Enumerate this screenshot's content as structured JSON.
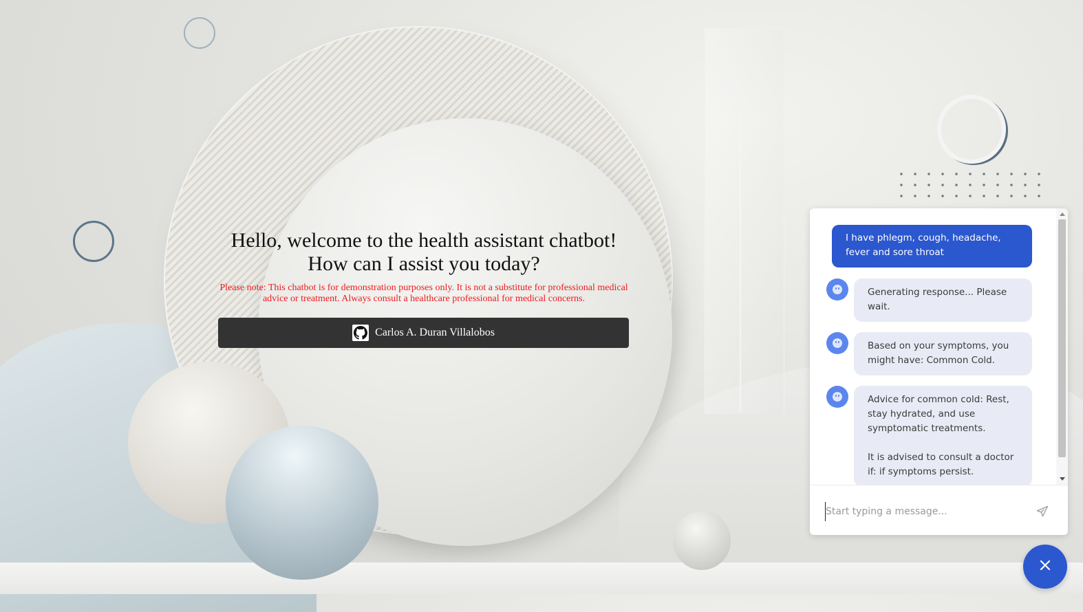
{
  "page": {
    "heading_line1": "Hello, welcome to the health assistant chatbot!",
    "heading_line2": "How can I assist you today?",
    "disclaimer": "Please note: This chatbot is for demonstration purposes only. It is not a substitute for professional medical advice or treatment. Always consult a healthcare professional for medical concerns.",
    "author_button_label": "Carlos A. Duran Villalobos",
    "author_button_icon": "github-icon"
  },
  "chat": {
    "messages": [
      {
        "sender": "user",
        "text": "I have phlegm, cough, headache, fever and sore throat"
      },
      {
        "sender": "bot",
        "text": "Generating response... Please wait."
      },
      {
        "sender": "bot",
        "text": "Based on your symptoms, you might have: Common Cold."
      },
      {
        "sender": "bot",
        "text": "Advice for common cold: Rest, stay hydrated, and use symptomatic treatments.\n\nIt is advised to consult a doctor if:  if symptoms persist."
      }
    ],
    "input_placeholder": "Start typing a message...",
    "input_value": "",
    "send_icon": "send-icon",
    "bot_avatar_icon": "bot-avatar-icon",
    "close_icon": "close-icon"
  },
  "colors": {
    "accent": "#2b57cf",
    "bot_bubble": "#e8ebf5",
    "disclaimer": "#ee1b1b",
    "author_button": "#333333"
  }
}
